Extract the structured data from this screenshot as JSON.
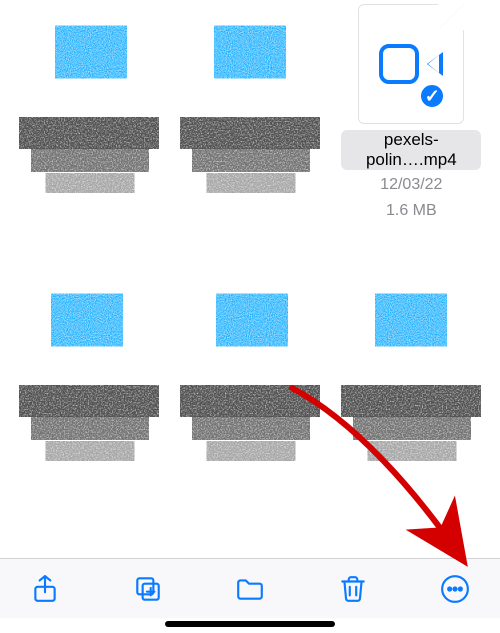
{
  "grid": {
    "items": [
      {
        "kind": "loading"
      },
      {
        "kind": "loading"
      },
      {
        "kind": "video-file",
        "selected": true,
        "name": "pexels-polin….mp4",
        "date": "12/03/22",
        "size": "1.6 MB"
      },
      {
        "kind": "loading"
      },
      {
        "kind": "loading"
      },
      {
        "kind": "loading"
      }
    ]
  },
  "toolbar": {
    "share": "Share",
    "duplicate": "Duplicate",
    "move": "Move",
    "delete": "Delete",
    "more": "More"
  },
  "colors": {
    "accent": "#0a7aff"
  },
  "annotation": {
    "arrow_points_to": "more-button"
  }
}
